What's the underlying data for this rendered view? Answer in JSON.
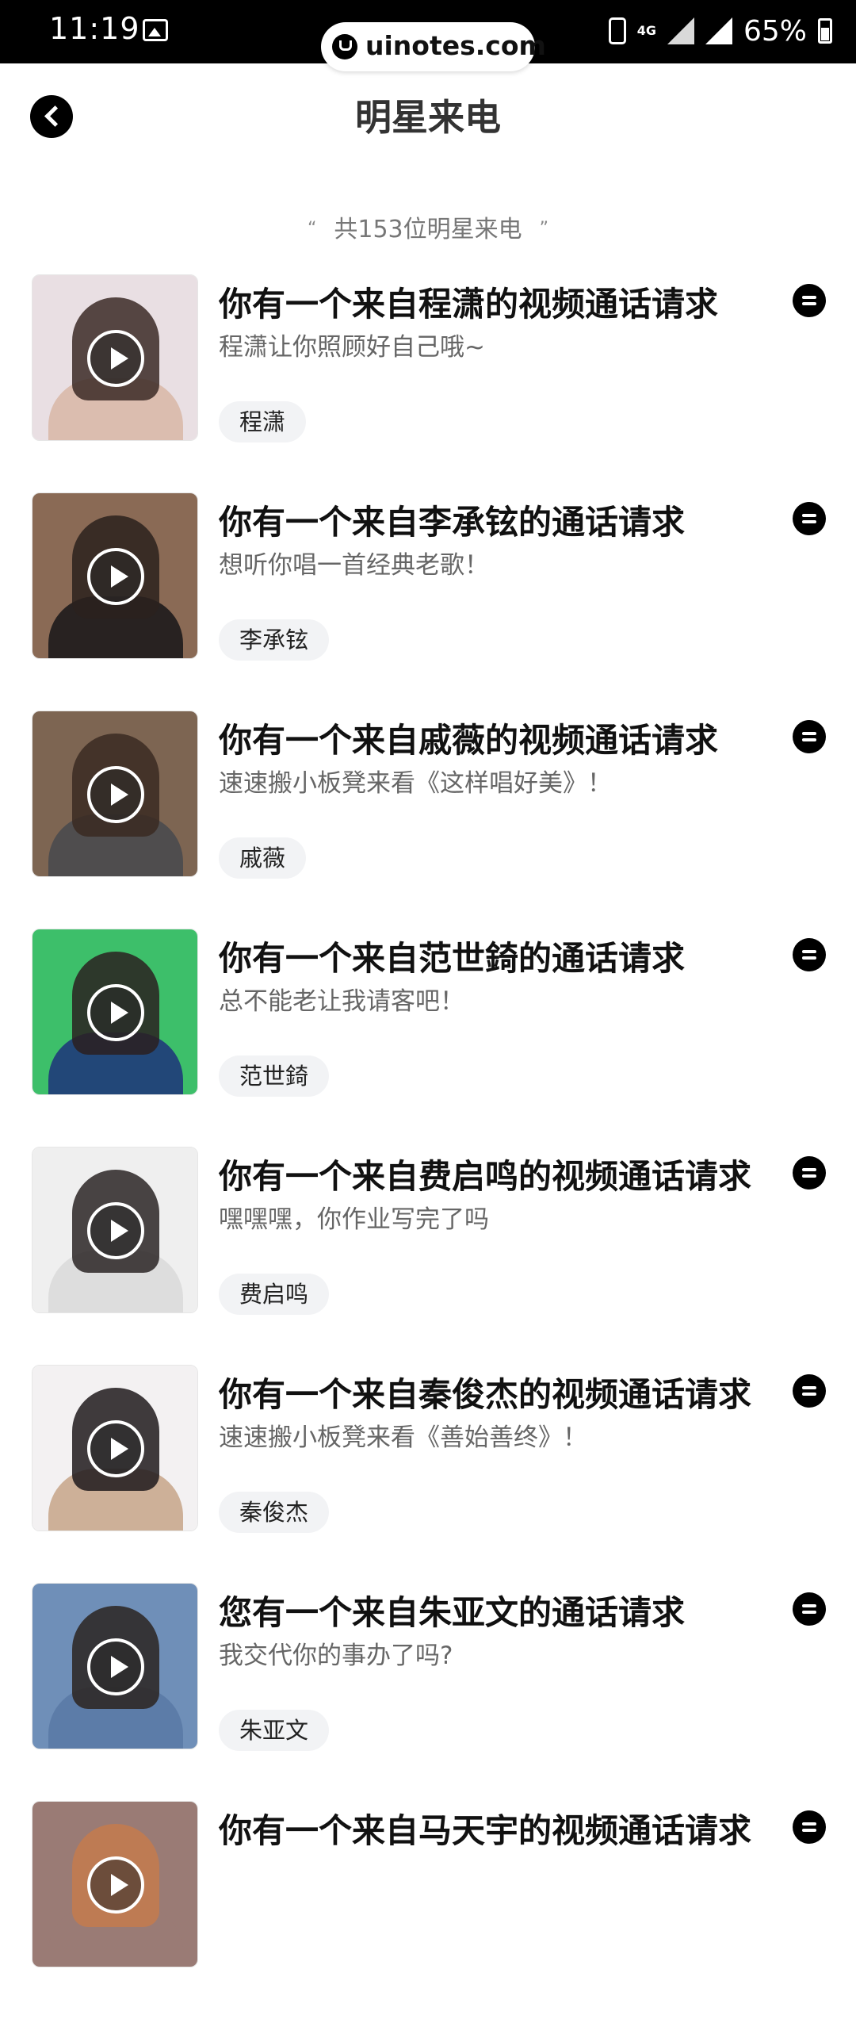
{
  "status_bar": {
    "time": "11:19",
    "network": "4G",
    "battery": "65%",
    "domain_badge": "uinotes.com"
  },
  "header": {
    "title": "明星来电"
  },
  "summary": {
    "open_quote": "“",
    "text": "共153位明星来电",
    "close_quote": "”"
  },
  "items": [
    {
      "title": "你有一个来自程潇的视频通话请求",
      "subtitle": "程潇让你照顾好自己哦~",
      "tag": "程潇",
      "bg": "#e9dfe3",
      "fig": "#3b2a26",
      "body": "#d9b9a8"
    },
    {
      "title": "你有一个来自李承铉的通话请求",
      "subtitle": "想听你唱一首经典老歌！",
      "tag": "李承铉",
      "bg": "#8a6a55",
      "fig": "#2a211d",
      "body": "#1d1b1c"
    },
    {
      "title": "你有一个来自戚薇的视频通话请求",
      "subtitle": "速速搬小板凳来看《这样唱好美》！",
      "tag": "戚薇",
      "bg": "#7d6552",
      "fig": "#3a2a22",
      "body": "#4a4a4e"
    },
    {
      "title": "你有一个来自范世錡的通话请求",
      "subtitle": "总不能老让我请客吧！",
      "tag": "范世錡",
      "bg": "#3dbf6a",
      "fig": "#2a2020",
      "body": "#1f3a7a"
    },
    {
      "title": "你有一个来自费启鸣的视频通话请求",
      "subtitle": "嘿嘿嘿，你作业写完了吗",
      "tag": "费启鸣",
      "bg": "#efefef",
      "fig": "#2a2424",
      "body": "#dadada"
    },
    {
      "title": "你有一个来自秦俊杰的视频通话请求",
      "subtitle": "速速搬小板凳来看《善始善终》！",
      "tag": "秦俊杰",
      "bg": "#f3f1f2",
      "fig": "#1e1a1c",
      "body": "#c9a88e"
    },
    {
      "title": "您有一个来自朱亚文的通话请求",
      "subtitle": "我交代你的事办了吗?",
      "tag": "朱亚文",
      "bg": "#6f8fb8",
      "fig": "#2b2520",
      "body": "#5a7aa6"
    },
    {
      "title": "你有一个来自马天宇的视频通话请求",
      "subtitle": "",
      "tag": "",
      "bg": "#9a7b75",
      "fig": "#c47b4e",
      "body": "#9a7b75"
    }
  ]
}
